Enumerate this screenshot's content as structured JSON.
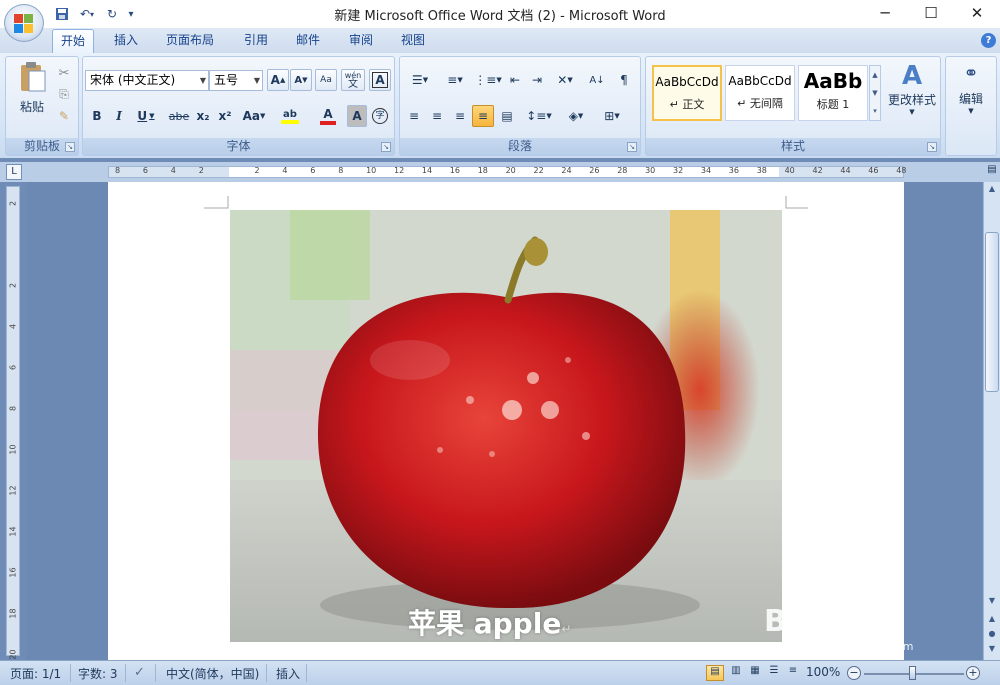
{
  "window": {
    "title": "新建 Microsoft Office Word 文档 (2) - Microsoft Word",
    "minimize": "─",
    "maximize": "☐",
    "close": "✕"
  },
  "qat": {
    "customize": "▾"
  },
  "tabs": [
    {
      "label": "开始",
      "active": true
    },
    {
      "label": "插入"
    },
    {
      "label": "页面布局"
    },
    {
      "label": "引用"
    },
    {
      "label": "邮件"
    },
    {
      "label": "审阅"
    },
    {
      "label": "视图"
    }
  ],
  "help": "?",
  "ribbon": {
    "clipboard": {
      "label": "剪贴板",
      "paste": "粘贴"
    },
    "font": {
      "label": "字体",
      "font_name": "宋体 (中文正文)",
      "font_size": "五号",
      "grow": "A",
      "shrink": "A",
      "bold": "B",
      "italic": "I",
      "underline": "U",
      "strike": "abe",
      "subscript": "x₂",
      "superscript": "x²",
      "change_case": "Aa",
      "highlight": "ab",
      "font_color": "A",
      "char_shading": "A",
      "enclose": "字",
      "phonetic": "wén",
      "clear": "Aa",
      "border": "A"
    },
    "paragraph": {
      "label": "段落"
    },
    "styles": {
      "label": "样式",
      "items": [
        {
          "sample": "AaBbCcDd",
          "name": "↵ 正文",
          "selected": true
        },
        {
          "sample": "AaBbCcDd",
          "name": "↵ 无间隔"
        },
        {
          "sample": "AaBb",
          "name": "标题 1"
        }
      ],
      "change_styles": "更改样式"
    },
    "editing": {
      "label": "编辑"
    }
  },
  "ruler": {
    "ticks": [
      "8",
      "6",
      "4",
      "2",
      "",
      "2",
      "4",
      "6",
      "8",
      "10",
      "12",
      "14",
      "16",
      "18",
      "20",
      "22",
      "24",
      "26",
      "28",
      "30",
      "32",
      "34",
      "36",
      "38",
      "40",
      "42",
      "44",
      "46",
      "48"
    ],
    "vticks": [
      "2",
      "",
      "2",
      "4",
      "6",
      "8",
      "10",
      "12",
      "14",
      "16",
      "18",
      "20"
    ]
  },
  "document": {
    "caption": "苹果 apple",
    "paragraph_mark": "↵"
  },
  "status": {
    "page": "页面: 1/1",
    "words": "字数: 3",
    "language": "中文(简体，中国)",
    "mode": "插入",
    "zoom": "100%"
  },
  "watermark": {
    "text": "Bai 经验",
    "url": "jingyan.baidu.com"
  },
  "colors": {
    "accent": "#15428b",
    "apple_red": "#c8171c",
    "ribbon_bg": "#dbe7f6"
  }
}
